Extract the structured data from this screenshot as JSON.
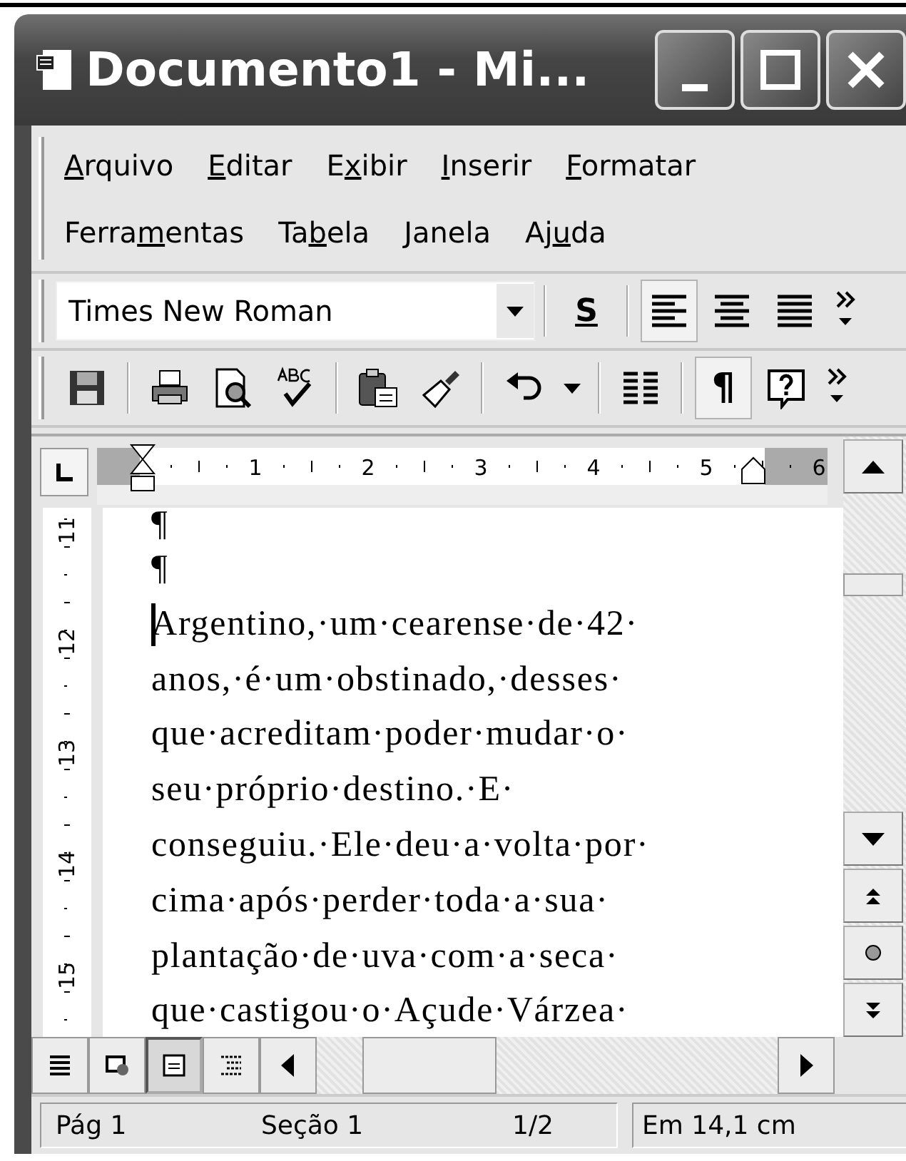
{
  "window": {
    "title": "Documento1 - Mi..."
  },
  "menu_rows": [
    [
      {
        "key": "A",
        "after": "rquivo"
      },
      {
        "key": "E",
        "after": "ditar"
      },
      {
        "before": "E",
        "key": "x",
        "after": "ibir"
      },
      {
        "key": "I",
        "after": "nserir"
      },
      {
        "key": "F",
        "after": "ormatar"
      }
    ],
    [
      {
        "before": "Ferra",
        "key": "m",
        "after": "entas"
      },
      {
        "before": "Ta",
        "key": "b",
        "after": "ela"
      },
      {
        "key": "J",
        "after": "anela"
      },
      {
        "before": "Aj",
        "key": "u",
        "after": "da"
      }
    ]
  ],
  "formatting_toolbar": {
    "font": "Times New Roman",
    "buttons": [
      {
        "kind": "separator"
      },
      {
        "kind": "underline",
        "label": "S",
        "pressed": false
      },
      {
        "kind": "separator"
      },
      {
        "kind": "align-left",
        "pressed": true
      },
      {
        "kind": "align-center",
        "pressed": false
      },
      {
        "kind": "justify",
        "pressed": false
      },
      {
        "kind": "overflow",
        "pressed": false
      }
    ]
  },
  "standard_toolbar": {
    "buttons": [
      {
        "kind": "save",
        "pressed": false
      },
      {
        "kind": "separator"
      },
      {
        "kind": "print",
        "pressed": false
      },
      {
        "kind": "preview",
        "pressed": false
      },
      {
        "kind": "spelling",
        "pressed": false
      },
      {
        "kind": "separator"
      },
      {
        "kind": "paste",
        "pressed": false
      },
      {
        "kind": "painter",
        "pressed": false
      },
      {
        "kind": "separator"
      },
      {
        "kind": "undo",
        "pressed": false
      },
      {
        "kind": "dropdown",
        "pressed": false
      },
      {
        "kind": "separator"
      },
      {
        "kind": "columns",
        "pressed": false
      },
      {
        "kind": "separator"
      },
      {
        "kind": "pilcrow",
        "label": "¶",
        "pressed": true
      },
      {
        "kind": "help",
        "pressed": false
      },
      {
        "kind": "overflow",
        "pressed": false
      }
    ]
  },
  "ruler": {
    "horizontal": [
      "1",
      "2",
      "3",
      "4",
      "5",
      "6"
    ],
    "vertical": [
      "11",
      "12",
      "13",
      "14",
      "15"
    ]
  },
  "document": {
    "lines": [
      {
        "text": "¶",
        "caret": false
      },
      {
        "text": "¶",
        "caret": false
      },
      {
        "text": "Argentino,·um·cearense·de·42·",
        "caret": true
      },
      {
        "text": "anos,·é·um·obstinado,·desses·",
        "caret": false
      },
      {
        "text": "que·acreditam·poder·mudar·o·",
        "caret": false
      },
      {
        "text": "seu·próprio·destino.·E·",
        "caret": false
      },
      {
        "text": "conseguiu.·Ele·deu·a·volta·por·",
        "caret": false
      },
      {
        "text": "cima·após·perder·toda·a·sua·",
        "caret": false
      },
      {
        "text": "plantação·de·uva·com·a·seca·",
        "caret": false
      },
      {
        "text": "que·castigou·o·Açude·Várzea·",
        "caret": false
      }
    ]
  },
  "view_buttons": [
    {
      "kind": "normal",
      "selected": false
    },
    {
      "kind": "web",
      "selected": false
    },
    {
      "kind": "print",
      "selected": true
    },
    {
      "kind": "outline",
      "selected": false
    }
  ],
  "status_bar": {
    "page": "Pág 1",
    "section": "Seção 1",
    "pages": "1/2",
    "position": "Em 14,1 cm"
  }
}
